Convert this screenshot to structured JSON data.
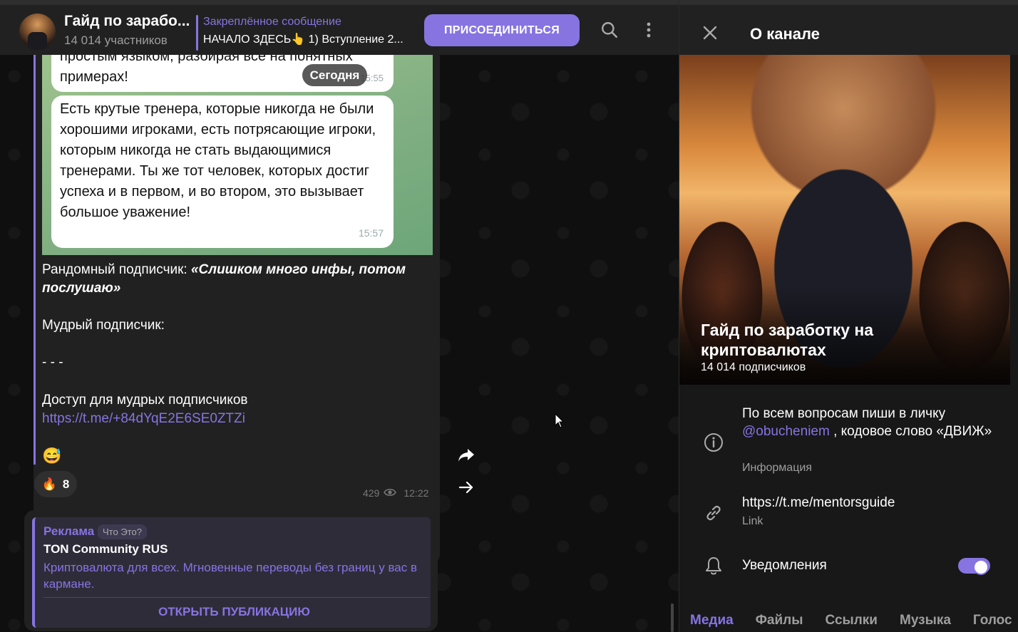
{
  "header": {
    "title": "Гайд по зарабо...",
    "subtitle": "14 014 участников",
    "pinned_title": "Закреплённое сообщение",
    "pinned_text": "НАЧАЛО ЗДЕСЬ👆 1) Вступление 2...",
    "join_label": "ПРИСОЕДИНИТЬСЯ"
  },
  "chat": {
    "bubble1_text": "простым языком, разбирая все на понятных примерах!",
    "bubble1_time": "15:55",
    "date_pill": "Сегодня",
    "bubble2_text": "Есть крутые тренера, которые никогда не были хорошими игроками, есть потрясающие игроки, которым никогда не стать выдающимися тренерами. Ты же тот человек, которых достиг успеха и в первом, и во втором, это вызывает большое уважение!",
    "bubble2_time": "15:57",
    "line1_prefix": "Рандомный подписчик: ",
    "line1_quote": "«Слишком много инфы, потом послушаю»",
    "line2": "Мудрый подписчик:",
    "line3": "- - -",
    "line4": "Доступ для мудрых подписчиков",
    "link": "https://t.me/+84dYqE2E6SE0ZTZi",
    "emoji": "😅",
    "reaction_emoji": "🔥",
    "reaction_count": "8",
    "views": "429",
    "time": "12:22"
  },
  "ad": {
    "label": "Реклама",
    "what": "Что Это?",
    "name": "TON Community RUS",
    "desc": "Криптовалюта для всех. Мгновенные переводы без границ у вас в кармане.",
    "button": "ОТКРЫТЬ ПУБЛИКАЦИЮ"
  },
  "panel": {
    "title": "О канале",
    "cover_title": "Гайд по заработку на криптовалютах",
    "cover_sub": "14 014 подписчиков",
    "info_prefix": "По всем вопросам пиши в личку ",
    "info_link": "@obucheniem",
    "info_suffix": " , кодовое слово «ДВИЖ»",
    "info_label": "Информация",
    "link_value": "https://t.me/mentorsguide",
    "link_label": "Link",
    "notif_label": "Уведомления",
    "notifications_on": true,
    "tabs": [
      "Медиа",
      "Файлы",
      "Ссылки",
      "Музыка",
      "Голос"
    ]
  },
  "colors": {
    "accent": "#8774e1",
    "bg": "#0f0f0f",
    "panel": "#212121"
  }
}
